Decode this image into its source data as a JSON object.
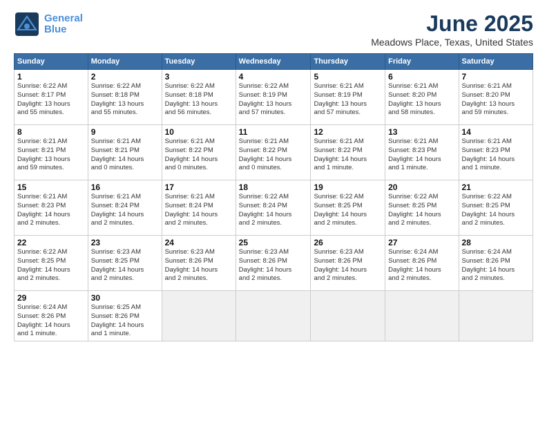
{
  "logo": {
    "line1": "General",
    "line2": "Blue"
  },
  "title": "June 2025",
  "subtitle": "Meadows Place, Texas, United States",
  "days_of_week": [
    "Sunday",
    "Monday",
    "Tuesday",
    "Wednesday",
    "Thursday",
    "Friday",
    "Saturday"
  ],
  "weeks": [
    [
      {
        "day": "1",
        "info": "Sunrise: 6:22 AM\nSunset: 8:17 PM\nDaylight: 13 hours\nand 55 minutes."
      },
      {
        "day": "2",
        "info": "Sunrise: 6:22 AM\nSunset: 8:18 PM\nDaylight: 13 hours\nand 55 minutes."
      },
      {
        "day": "3",
        "info": "Sunrise: 6:22 AM\nSunset: 8:18 PM\nDaylight: 13 hours\nand 56 minutes."
      },
      {
        "day": "4",
        "info": "Sunrise: 6:22 AM\nSunset: 8:19 PM\nDaylight: 13 hours\nand 57 minutes."
      },
      {
        "day": "5",
        "info": "Sunrise: 6:21 AM\nSunset: 8:19 PM\nDaylight: 13 hours\nand 57 minutes."
      },
      {
        "day": "6",
        "info": "Sunrise: 6:21 AM\nSunset: 8:20 PM\nDaylight: 13 hours\nand 58 minutes."
      },
      {
        "day": "7",
        "info": "Sunrise: 6:21 AM\nSunset: 8:20 PM\nDaylight: 13 hours\nand 59 minutes."
      }
    ],
    [
      {
        "day": "8",
        "info": "Sunrise: 6:21 AM\nSunset: 8:21 PM\nDaylight: 13 hours\nand 59 minutes."
      },
      {
        "day": "9",
        "info": "Sunrise: 6:21 AM\nSunset: 8:21 PM\nDaylight: 14 hours\nand 0 minutes."
      },
      {
        "day": "10",
        "info": "Sunrise: 6:21 AM\nSunset: 8:22 PM\nDaylight: 14 hours\nand 0 minutes."
      },
      {
        "day": "11",
        "info": "Sunrise: 6:21 AM\nSunset: 8:22 PM\nDaylight: 14 hours\nand 0 minutes."
      },
      {
        "day": "12",
        "info": "Sunrise: 6:21 AM\nSunset: 8:22 PM\nDaylight: 14 hours\nand 1 minute."
      },
      {
        "day": "13",
        "info": "Sunrise: 6:21 AM\nSunset: 8:23 PM\nDaylight: 14 hours\nand 1 minute."
      },
      {
        "day": "14",
        "info": "Sunrise: 6:21 AM\nSunset: 8:23 PM\nDaylight: 14 hours\nand 1 minute."
      }
    ],
    [
      {
        "day": "15",
        "info": "Sunrise: 6:21 AM\nSunset: 8:23 PM\nDaylight: 14 hours\nand 2 minutes."
      },
      {
        "day": "16",
        "info": "Sunrise: 6:21 AM\nSunset: 8:24 PM\nDaylight: 14 hours\nand 2 minutes."
      },
      {
        "day": "17",
        "info": "Sunrise: 6:21 AM\nSunset: 8:24 PM\nDaylight: 14 hours\nand 2 minutes."
      },
      {
        "day": "18",
        "info": "Sunrise: 6:22 AM\nSunset: 8:24 PM\nDaylight: 14 hours\nand 2 minutes."
      },
      {
        "day": "19",
        "info": "Sunrise: 6:22 AM\nSunset: 8:25 PM\nDaylight: 14 hours\nand 2 minutes."
      },
      {
        "day": "20",
        "info": "Sunrise: 6:22 AM\nSunset: 8:25 PM\nDaylight: 14 hours\nand 2 minutes."
      },
      {
        "day": "21",
        "info": "Sunrise: 6:22 AM\nSunset: 8:25 PM\nDaylight: 14 hours\nand 2 minutes."
      }
    ],
    [
      {
        "day": "22",
        "info": "Sunrise: 6:22 AM\nSunset: 8:25 PM\nDaylight: 14 hours\nand 2 minutes."
      },
      {
        "day": "23",
        "info": "Sunrise: 6:23 AM\nSunset: 8:25 PM\nDaylight: 14 hours\nand 2 minutes."
      },
      {
        "day": "24",
        "info": "Sunrise: 6:23 AM\nSunset: 8:26 PM\nDaylight: 14 hours\nand 2 minutes."
      },
      {
        "day": "25",
        "info": "Sunrise: 6:23 AM\nSunset: 8:26 PM\nDaylight: 14 hours\nand 2 minutes."
      },
      {
        "day": "26",
        "info": "Sunrise: 6:23 AM\nSunset: 8:26 PM\nDaylight: 14 hours\nand 2 minutes."
      },
      {
        "day": "27",
        "info": "Sunrise: 6:24 AM\nSunset: 8:26 PM\nDaylight: 14 hours\nand 2 minutes."
      },
      {
        "day": "28",
        "info": "Sunrise: 6:24 AM\nSunset: 8:26 PM\nDaylight: 14 hours\nand 2 minutes."
      }
    ],
    [
      {
        "day": "29",
        "info": "Sunrise: 6:24 AM\nSunset: 8:26 PM\nDaylight: 14 hours\nand 1 minute."
      },
      {
        "day": "30",
        "info": "Sunrise: 6:25 AM\nSunset: 8:26 PM\nDaylight: 14 hours\nand 1 minute."
      },
      {
        "day": "",
        "info": ""
      },
      {
        "day": "",
        "info": ""
      },
      {
        "day": "",
        "info": ""
      },
      {
        "day": "",
        "info": ""
      },
      {
        "day": "",
        "info": ""
      }
    ]
  ]
}
